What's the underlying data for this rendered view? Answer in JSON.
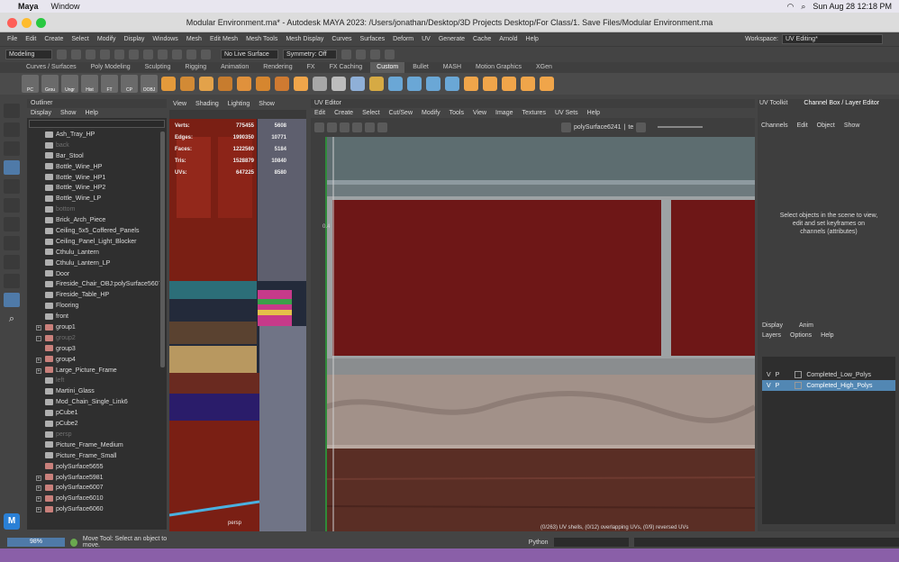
{
  "macbar": {
    "app": "Maya",
    "window": "Window",
    "datetime": "Sun Aug 28  12:18 PM"
  },
  "title": "Modular Environment.ma* - Autodesk MAYA 2023: /Users/jonathan/Desktop/3D Projects Desktop/For Class/1. Save Files/Modular Environment.ma",
  "menus": [
    "File",
    "Edit",
    "Create",
    "Select",
    "Modify",
    "Display",
    "Windows",
    "Mesh",
    "Edit Mesh",
    "Mesh Tools",
    "Mesh Display",
    "Curves",
    "Surfaces",
    "Deform",
    "UV",
    "Generate",
    "Cache",
    "Arnold",
    "Help"
  ],
  "workspace": {
    "label": "Workspace:",
    "value": "UV Editing*"
  },
  "statusline": {
    "mode": "Modeling",
    "live": "No Live Surface",
    "symmetry": "Symmetry: Off"
  },
  "shelftabs": [
    "Curves / Surfaces",
    "Poly Modeling",
    "Sculpting",
    "Rigging",
    "Animation",
    "Rendering",
    "FX",
    "FX Caching",
    "Custom",
    "Bullet",
    "MASH",
    "Motion Graphics",
    "XGen"
  ],
  "shelf": {
    "buttons": [
      "PC",
      "Grou",
      "Ungr",
      "Hist",
      "FT",
      "CP",
      "OOBJ"
    ],
    "icon_colors": [
      "#e49a3b",
      "#d28a35",
      "#e3a24a",
      "#c77c2e",
      "#e0913c",
      "#d6862f",
      "#cf7a31",
      "#f0a54a",
      "#a7a7a7",
      "#bdbdbd",
      "#8fb0d8",
      "#d6aa44",
      "#6aa7d6",
      "#6aa7d6",
      "#6aa7d6",
      "#6aa7d6",
      "#f0a54a",
      "#f0a54a",
      "#f0a54a",
      "#f0a54a",
      "#f0a54a"
    ]
  },
  "outliner": {
    "title": "Outliner",
    "menu": [
      "Display",
      "Show",
      "Help"
    ],
    "items": [
      {
        "name": "Ash_Tray_HP",
        "t": "mesh"
      },
      {
        "name": "back",
        "t": "cam",
        "dim": true
      },
      {
        "name": "Bar_Stool",
        "t": "mesh"
      },
      {
        "name": "Bottle_Wine_HP",
        "t": "mesh"
      },
      {
        "name": "Bottle_Wine_HP1",
        "t": "mesh"
      },
      {
        "name": "Bottle_Wine_HP2",
        "t": "mesh"
      },
      {
        "name": "Bottle_Wine_LP",
        "t": "mesh"
      },
      {
        "name": "bottom",
        "t": "cam",
        "dim": true
      },
      {
        "name": "Brick_Arch_Piece",
        "t": "mesh"
      },
      {
        "name": "Ceiling_5x5_Coffered_Panels",
        "t": "mesh"
      },
      {
        "name": "Ceiling_Panel_Light_Blocker",
        "t": "mesh"
      },
      {
        "name": "Cthulu_Lantern",
        "t": "mesh"
      },
      {
        "name": "Cthulu_Lantern_LP",
        "t": "mesh"
      },
      {
        "name": "Door",
        "t": "mesh"
      },
      {
        "name": "Fireside_Chair_OBJ:polySurface5607",
        "t": "mesh"
      },
      {
        "name": "Fireside_Table_HP",
        "t": "mesh"
      },
      {
        "name": "Flooring",
        "t": "mesh"
      },
      {
        "name": "front",
        "t": "cam"
      },
      {
        "name": "group1",
        "t": "grp",
        "exp": true
      },
      {
        "name": "group2",
        "t": "grp",
        "exp": true,
        "dim": true
      },
      {
        "name": "group3",
        "t": "grp"
      },
      {
        "name": "group4",
        "t": "grp",
        "exp": true
      },
      {
        "name": "Large_Picture_Frame",
        "t": "grp",
        "exp": true
      },
      {
        "name": "left",
        "t": "cam",
        "dim": true
      },
      {
        "name": "Martini_Glass",
        "t": "mesh"
      },
      {
        "name": "Mod_Chain_Single_Link6",
        "t": "mesh"
      },
      {
        "name": "pCube1",
        "t": "mesh"
      },
      {
        "name": "pCube2",
        "t": "mesh"
      },
      {
        "name": "persp",
        "t": "cam",
        "dim": true
      },
      {
        "name": "Picture_Frame_Medium",
        "t": "mesh"
      },
      {
        "name": "Picture_Frame_Small",
        "t": "mesh"
      },
      {
        "name": "polySurface5655",
        "t": "grp"
      },
      {
        "name": "polySurface5981",
        "t": "grp",
        "exp": true
      },
      {
        "name": "polySurface6007",
        "t": "grp",
        "exp": true
      },
      {
        "name": "polySurface6010",
        "t": "grp",
        "exp": true
      },
      {
        "name": "polySurface6060",
        "t": "grp",
        "exp": true
      }
    ]
  },
  "viewport": {
    "menu": [
      "View",
      "Shading",
      "Lighting",
      "Show"
    ],
    "label": "persp",
    "hud": [
      [
        "Verts:",
        "775455",
        "5608"
      ],
      [
        "Edges:",
        "1990350",
        "10771"
      ],
      [
        "Faces:",
        "1222560",
        "5184"
      ],
      [
        "Tris:",
        "1528879",
        "10840"
      ],
      [
        "UVs:",
        "647225",
        "8580"
      ]
    ]
  },
  "uv": {
    "title": "UV Editor",
    "menu": [
      "Edit",
      "Create",
      "Select",
      "Cut/Sew",
      "Modify",
      "Tools",
      "View",
      "Image",
      "Textures",
      "UV Sets",
      "Help"
    ],
    "surface": "polySurface6241",
    "tex": "te",
    "tick": "0.4",
    "status": "(0/263) UV shells, (0/12) overlapping UVs, (0/9) reversed UVs"
  },
  "channelbox": {
    "toolkit": "UV Toolkit",
    "title": "Channel Box / Layer Editor",
    "menu": [
      "Channels",
      "Edit",
      "Object",
      "Show"
    ],
    "msg": "Select objects in the scene to view, edit and set keyframes on channels (attributes)",
    "tabs": [
      "Display",
      "Anim"
    ],
    "layermenu": [
      "Layers",
      "Options",
      "Help"
    ],
    "layers": [
      {
        "v": "V",
        "p": "P",
        "name": "Completed_Low_Polys"
      },
      {
        "v": "V",
        "p": "P",
        "name": "Completed_High_Polys"
      }
    ]
  },
  "helpline": {
    "progress": "98%",
    "msg": "Move Tool: Select an object to move.",
    "python": "Python"
  }
}
